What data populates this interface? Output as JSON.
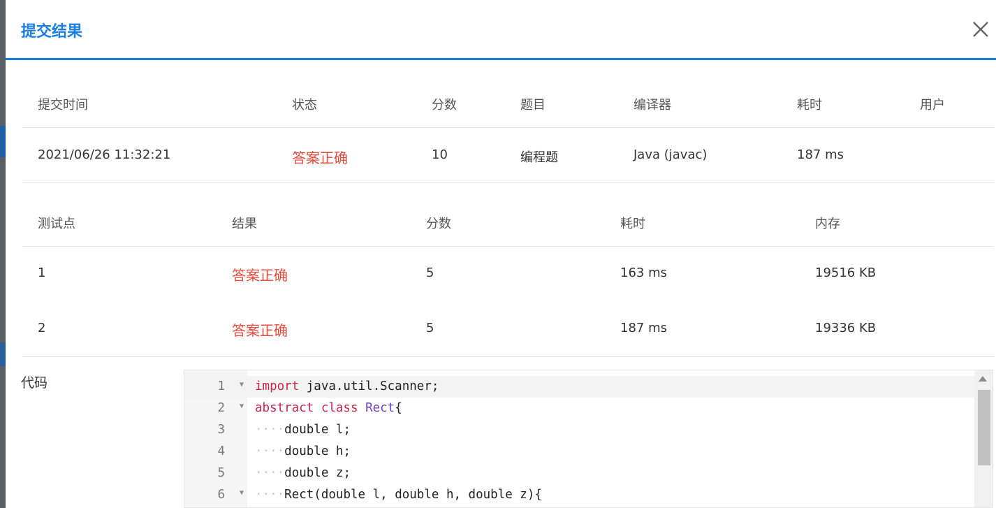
{
  "dialog": {
    "title": "提交结果"
  },
  "summary": {
    "headers": [
      "提交时间",
      "状态",
      "分数",
      "题目",
      "编译器",
      "耗时",
      "用户"
    ],
    "row": {
      "submit_time": "2021/06/26 11:32:21",
      "status": "答案正确",
      "score": "10",
      "problem": "编程题",
      "compiler": "Java (javac)",
      "time": "187 ms",
      "user": ""
    }
  },
  "testcases": {
    "headers": [
      "测试点",
      "结果",
      "分数",
      "耗时",
      "内存"
    ],
    "rows": [
      {
        "id": "1",
        "result": "答案正确",
        "score": "5",
        "time": "163 ms",
        "memory": "19516 KB"
      },
      {
        "id": "2",
        "result": "答案正确",
        "score": "5",
        "time": "187 ms",
        "memory": "19336 KB"
      }
    ]
  },
  "code": {
    "label": "代码",
    "lines": [
      {
        "n": "1",
        "kw": "import",
        "rest": " java.util.Scanner;"
      },
      {
        "n": "2",
        "kw": "abstract class",
        "cls": "Rect",
        "rest": "{"
      },
      {
        "n": "3",
        "indent": "····",
        "rest": "double l;"
      },
      {
        "n": "4",
        "indent": "····",
        "rest": "double h;"
      },
      {
        "n": "5",
        "indent": "····",
        "rest": "double z;"
      },
      {
        "n": "6",
        "indent": "····",
        "rest": "Rect(double l, double h, double z){"
      }
    ]
  },
  "colors": {
    "accent": "#1a7fe0",
    "success": "#e64b3c"
  }
}
